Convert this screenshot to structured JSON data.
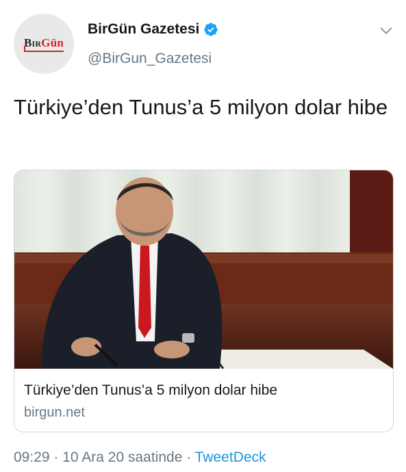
{
  "account": {
    "display_name": "BirGün Gazetesi",
    "handle": "@BirGun_Gazetesi",
    "avatar_logo_bir": "Bir",
    "avatar_logo_gun": "Gün",
    "verified": true
  },
  "tweet": {
    "text": "Türkiye’den Tunus’a 5 milyon dolar hibe"
  },
  "card": {
    "title": "Türkiye’den Tunus’a 5 milyon dolar hibe",
    "domain": "birgun.net",
    "image_alt": "photo"
  },
  "meta": {
    "time": "09:29",
    "separator": " · ",
    "date": "10 Ara 20 saatinde",
    "source": "TweetDeck"
  },
  "icons": {
    "verified": "verified-badge-icon",
    "menu": "chevron-down-icon"
  },
  "colors": {
    "verified_blue": "#1da1f2",
    "link_blue": "#1b95e0",
    "secondary_text": "#657786",
    "brand_red": "#d32027"
  }
}
